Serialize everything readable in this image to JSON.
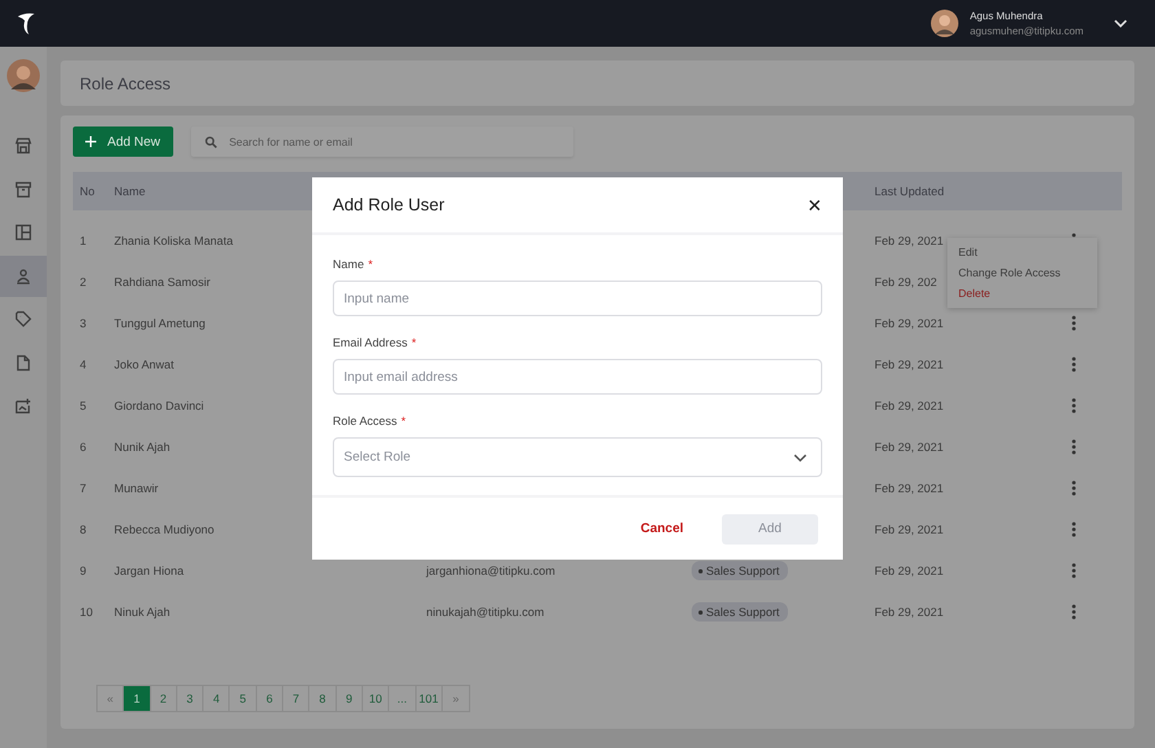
{
  "topbar": {
    "user_name": "Agus Muhendra",
    "user_email": "agusmuhen@titipku.com"
  },
  "sidebar": {
    "items": [
      {
        "selected": false
      },
      {
        "selected": false
      },
      {
        "selected": false
      },
      {
        "selected": true
      },
      {
        "selected": false
      },
      {
        "selected": false
      },
      {
        "selected": false
      }
    ]
  },
  "page_title": "Role Access",
  "add_button": "Add New",
  "search": {
    "placeholder": "Search for name or email"
  },
  "table": {
    "columns": [
      "No",
      "Name",
      "Last Updated"
    ],
    "rows": [
      {
        "no": "1",
        "name": "Zhania Koliska Manata",
        "updated": "Feb 29, 2021",
        "menu": [
          {
            "label": "Edit",
            "kind": "normal"
          },
          {
            "label": "Change Role Access",
            "kind": "normal"
          },
          {
            "label": "Delete",
            "kind": "danger"
          }
        ]
      },
      {
        "no": "2",
        "name": "Rahdiana Samosir",
        "updated": "Feb 29, 202"
      },
      {
        "no": "3",
        "name": "Tunggul Ametung",
        "updated": "Feb 29, 2021"
      },
      {
        "no": "4",
        "name": "Joko Anwat",
        "updated": "Feb 29, 2021"
      },
      {
        "no": "5",
        "name": "Giordano Davinci",
        "updated": "Feb 29, 2021"
      },
      {
        "no": "6",
        "name": "Nunik Ajah",
        "updated": "Feb 29, 2021"
      },
      {
        "no": "7",
        "name": "Munawir",
        "updated": "Feb 29, 2021"
      },
      {
        "no": "8",
        "name": "Rebecca Mudiyono",
        "updated": "Feb 29, 2021"
      },
      {
        "no": "9",
        "name": "Jargan Hiona",
        "email": "jarganhiona@titipku.com",
        "role": "Sales Support",
        "updated": "Feb 29, 2021"
      },
      {
        "no": "10",
        "name": "Ninuk Ajah",
        "email": "ninukajah@titipku.com",
        "role": "Sales Support",
        "updated": "Feb 29, 2021"
      }
    ]
  },
  "pagination": {
    "prev": "«",
    "pages": [
      {
        "label": "1",
        "selected": true
      },
      {
        "label": "2",
        "selected": false
      },
      {
        "label": "3",
        "selected": false
      },
      {
        "label": "4",
        "selected": false
      },
      {
        "label": "5",
        "selected": false
      },
      {
        "label": "6",
        "selected": false
      },
      {
        "label": "7",
        "selected": false
      },
      {
        "label": "8",
        "selected": false
      },
      {
        "label": "9",
        "selected": false
      },
      {
        "label": "10",
        "selected": false
      },
      {
        "label": "...",
        "selected": false
      },
      {
        "label": "101",
        "selected": false
      }
    ],
    "next": "»"
  },
  "dialog": {
    "title": "Add Role User",
    "close": "✕",
    "fields": [
      {
        "label": "Name",
        "required_mark": "*",
        "kind": "text",
        "placeholder": "Input name"
      },
      {
        "label": "Email Address",
        "required_mark": "*",
        "kind": "text",
        "placeholder": "Input email address"
      },
      {
        "label": "Role Access",
        "required_mark": "*",
        "kind": "select",
        "placeholder": "Select Role"
      }
    ],
    "cancel": "Cancel",
    "submit": {
      "label": "Add",
      "disabled": true
    }
  }
}
